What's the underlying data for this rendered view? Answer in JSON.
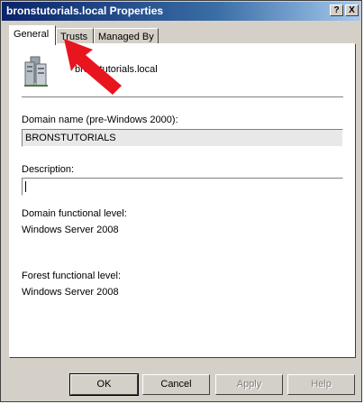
{
  "window": {
    "title": "bronstutorials.local Properties",
    "help_label": "?",
    "close_label": "X"
  },
  "tabs": [
    {
      "label": "General",
      "active": true
    },
    {
      "label": "Trusts",
      "active": false
    },
    {
      "label": "Managed By",
      "active": false
    }
  ],
  "domain": {
    "name": "bronstutorials.local",
    "icon": "domain-icon"
  },
  "fields": {
    "prewin2000_label": "Domain name (pre-Windows 2000):",
    "prewin2000_value": "BRONSTUTORIALS",
    "description_label": "Description:",
    "description_value": "",
    "domain_level_label": "Domain functional level:",
    "domain_level_value": "Windows Server 2008",
    "forest_level_label": "Forest functional level:",
    "forest_level_value": "Windows Server 2008"
  },
  "buttons": {
    "ok": "OK",
    "cancel": "Cancel",
    "apply": "Apply",
    "help": "Help"
  },
  "colors": {
    "titlebar_start": "#0a246a",
    "titlebar_end": "#a6caf0",
    "annotation_arrow": "#e8141e",
    "dialog_bg": "#d4d0c8"
  }
}
